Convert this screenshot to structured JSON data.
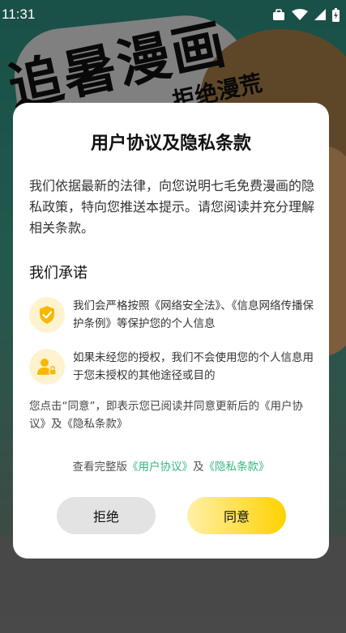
{
  "status_bar": {
    "time": "11:31",
    "icons": [
      "briefcase-icon",
      "wifi-icon",
      "signal-icon",
      "battery-icon"
    ]
  },
  "background": {
    "title_big": "追暑漫画",
    "title_small": "拒绝漫荒"
  },
  "dialog": {
    "title": "用户协议及隐私条款",
    "intro": "我们依据最新的法律，向您说明七毛免费漫画的隐私政策，特向您推送本提示。请您阅读并充分理解相关条款。",
    "promises_title": "我们承诺",
    "promises": [
      {
        "icon": "shield-check-icon",
        "text": "我们会严格按照《网络安全法》、《信息网络传播保护条例》等保护您的个人信息"
      },
      {
        "icon": "user-lock-icon",
        "text": "如果未经您的授权，我们不会使用您的个人信息用于您未授权的其他途径或目的"
      }
    ],
    "consent_text": "您点击“同意”，即表示您已阅读并同意更新后的《用户协议》及《隐私条款》",
    "links": {
      "prefix": "查看完整版",
      "user_agreement": "《用户协议》",
      "joiner": "及",
      "privacy_terms": "《隐私条款》"
    },
    "buttons": {
      "reject": "拒绝",
      "agree": "同意"
    }
  },
  "colors": {
    "link": "#34b77f",
    "accent": "#ffd200",
    "icon_bg": "#fff3cf",
    "icon": "#f6b800"
  }
}
